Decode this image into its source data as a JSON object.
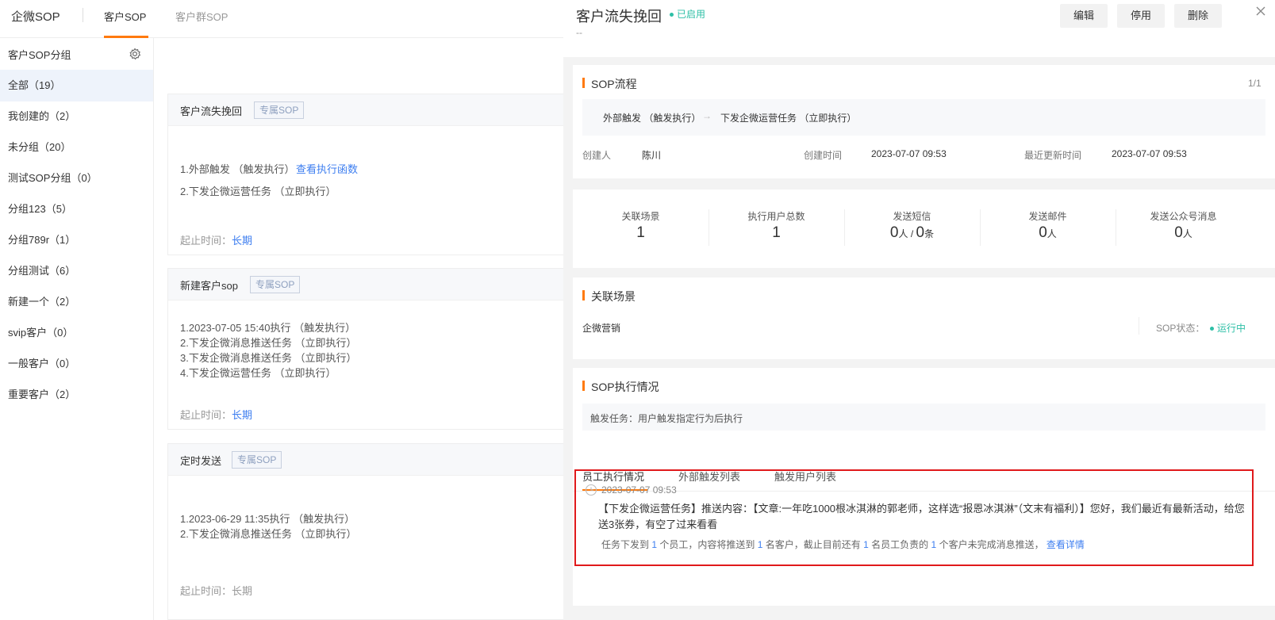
{
  "topbar": {
    "brand": "企微SOP",
    "tabs": [
      "客户SOP",
      "客户群SOP"
    ]
  },
  "sidebar": {
    "title": "客户SOP分组",
    "items": [
      "全部（19）",
      "我创建的（2）",
      "未分组（20）",
      "测试SOP分组（0）",
      "分组123（5）",
      "分组789r（1）",
      "分组测试（6）",
      "新建一个（2）",
      "svip客户（0）",
      "一般客户（0）",
      "重要客户（2）"
    ]
  },
  "cards": [
    {
      "title": "客户流失挽回",
      "tag": "专属SOP",
      "steps": [
        "1.外部触发 （触发执行）",
        "2.下发企微运营任务 （立即执行）"
      ],
      "step_link": "查看执行函数",
      "period_label": "起止时间：",
      "period_value": "长期"
    },
    {
      "title": "新建客户sop",
      "tag": "专属SOP",
      "steps": [
        "1.2023-07-05 15:40执行 （触发执行）",
        "2.下发企微消息推送任务 （立即执行）",
        "3.下发企微消息推送任务 （立即执行）",
        "4.下发企微运营任务 （立即执行）"
      ],
      "period_label": "起止时间：",
      "period_value": "长期"
    },
    {
      "title": "定时发送",
      "tag": "专属SOP",
      "steps": [
        "1.2023-06-29 11:35执行 （触发执行）",
        "2.下发企微消息推送任务 （立即执行）"
      ],
      "period_label": "起止时间：",
      "period_value": "长期"
    }
  ],
  "panel": {
    "title": "客户流失挽回",
    "status": "已启用",
    "subtitle": "--",
    "buttons": {
      "edit": "编辑",
      "disable": "停用",
      "delete": "删除"
    },
    "flow": {
      "title": "SOP流程",
      "page": "1/1",
      "step1": "外部触发 （触发执行）",
      "step2": "下发企微运营任务 （立即执行）",
      "creator_label": "创建人",
      "creator": "陈川",
      "created_label": "创建时间",
      "created": "2023-07-07 09:53",
      "updated_label": "最近更新时间",
      "updated": "2023-07-07 09:53"
    },
    "stats": [
      {
        "label": "关联场景",
        "value": "1"
      },
      {
        "label": "执行用户总数",
        "value": "1"
      },
      {
        "label": "发送短信",
        "v1": "0",
        "u1": "人",
        "sep": " / ",
        "v2": "0",
        "u2": "条"
      },
      {
        "label": "发送邮件",
        "value": "0",
        "unit": "人"
      },
      {
        "label": "发送公众号消息",
        "value": "0",
        "unit": "人"
      }
    ],
    "scene": {
      "title": "关联场景",
      "name": "企微营销",
      "status_label": "SOP状态：",
      "status": "运行中"
    },
    "exec": {
      "title": "SOP执行情况",
      "trigger": "触发任务：用户触发指定行为后执行",
      "tabs": [
        "员工执行情况",
        "外部触发列表",
        "触发用户列表"
      ],
      "record": {
        "time": "2023-07-07 09:53",
        "content": "【下发企微运营任务】推送内容：【文章:一年吃1000根冰淇淋的郭老师，这样选“报恩冰淇淋”（文末有福利）】您好，我们最近有最新活动，给您送3张券，有空了过来看看",
        "sum_a": "任务下发到",
        "n1": "1",
        "sum_b": "个员工，内容将推送到",
        "n2": "1",
        "sum_c": "名客户，截止目前还有",
        "n3": "1",
        "sum_d": "名员工负责的",
        "n4": "1",
        "sum_e": "个客户未完成消息推送，",
        "detail_link": "查看详情"
      }
    }
  }
}
